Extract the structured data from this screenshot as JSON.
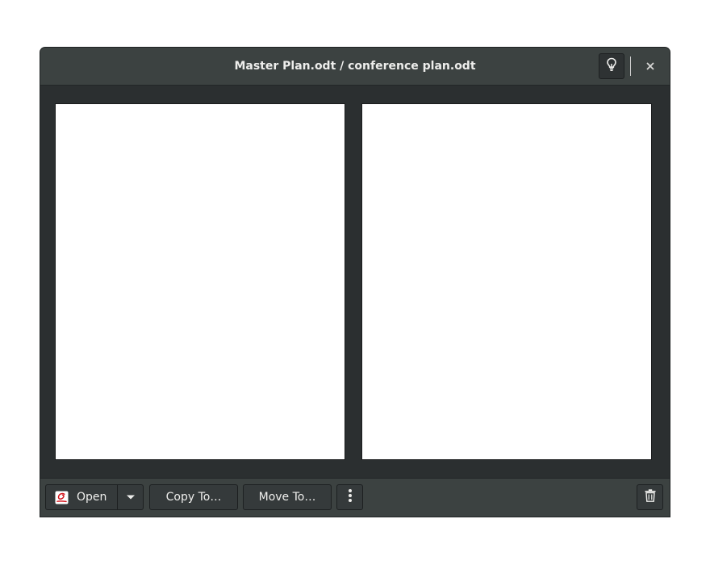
{
  "window": {
    "title": "Master Plan.odt / conference plan.odt"
  },
  "titlebar": {
    "hint_icon": "lightbulb-icon",
    "close_icon": "close-icon"
  },
  "actions": {
    "open_label": "Open",
    "open_icon": "document-app-icon",
    "open_menu_icon": "chevron-down-icon",
    "copy_label": "Copy To…",
    "move_label": "Move To…",
    "more_icon": "vertical-ellipsis-icon",
    "delete_icon": "trash-icon"
  },
  "colors": {
    "titlebar_bg": "#3c4241",
    "content_bg": "#2b2f30",
    "page_bg": "#ffffff",
    "text": "#eeeeec",
    "app_icon_red": "#d4151c"
  }
}
